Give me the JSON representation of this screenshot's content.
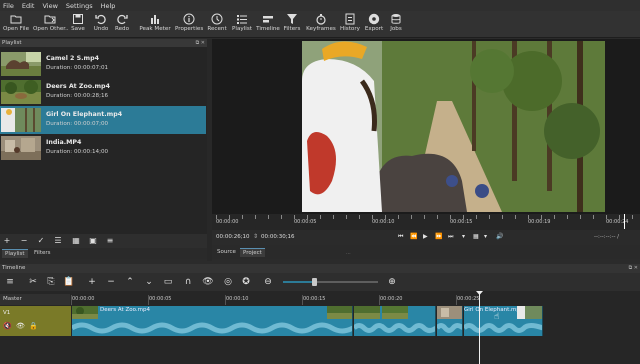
{
  "menu": [
    "File",
    "Edit",
    "View",
    "Settings",
    "Help"
  ],
  "toolbar": [
    {
      "label": "Open File",
      "icon": "open-file-icon"
    },
    {
      "label": "Open Other..",
      "icon": "open-other-icon"
    },
    {
      "label": "Save",
      "icon": "save-icon"
    },
    {
      "label": "Undo",
      "icon": "undo-icon"
    },
    {
      "label": "Redo",
      "icon": "redo-icon"
    },
    {
      "label": "Peak Meter",
      "icon": "peak-meter-icon"
    },
    {
      "label": "Properties",
      "icon": "properties-icon"
    },
    {
      "label": "Recent",
      "icon": "recent-icon"
    },
    {
      "label": "Playlist",
      "icon": "playlist-icon"
    },
    {
      "label": "Timeline",
      "icon": "timeline-icon"
    },
    {
      "label": "Filters",
      "icon": "filters-icon"
    },
    {
      "label": "Keyframes",
      "icon": "keyframes-icon"
    },
    {
      "label": "History",
      "icon": "history-icon"
    },
    {
      "label": "Export",
      "icon": "export-icon"
    },
    {
      "label": "Jobs",
      "icon": "jobs-icon"
    }
  ],
  "playlist": {
    "title": "Playlist",
    "items": [
      {
        "name": "Camel 2 S.mp4",
        "duration": "Duration: 00:00:07;01",
        "selected": false
      },
      {
        "name": "Deers At Zoo.mp4",
        "duration": "Duration: 00:00:28;16",
        "selected": false
      },
      {
        "name": "Girl On Elephant.mp4",
        "duration": "Duration: 00:00:07;00",
        "selected": true
      },
      {
        "name": "India.MP4",
        "duration": "Duration: 00:00:14;00",
        "selected": false
      }
    ],
    "tabs": [
      "Playlist",
      "Filters"
    ]
  },
  "viewer": {
    "ruler": [
      "00:00:00",
      "00:00:05",
      "00:00:10",
      "00:00:15",
      "00:00:19",
      "00:00:24"
    ],
    "timecode": "00:00:26;10",
    "duration": "00:00:30;16",
    "in_out": "--:--:--:-- /",
    "tabs": [
      "Source",
      "Project"
    ]
  },
  "timeline": {
    "title": "Timeline",
    "master_label": "Master",
    "track_name": "V1",
    "ruler": [
      "00:00:00",
      "00:00:05",
      "00:00:10",
      "00:00:15",
      "00:00:20",
      "00:00:25"
    ],
    "clips": [
      {
        "name": "Deers At Zoo.mp4"
      },
      {
        "name": ""
      },
      {
        "name": ""
      },
      {
        "name": "Girl On Elephant.mp4"
      }
    ]
  },
  "colors": {
    "accent": "#2c7b97",
    "clip": "#2986a6",
    "track_header": "#7a7a28"
  }
}
